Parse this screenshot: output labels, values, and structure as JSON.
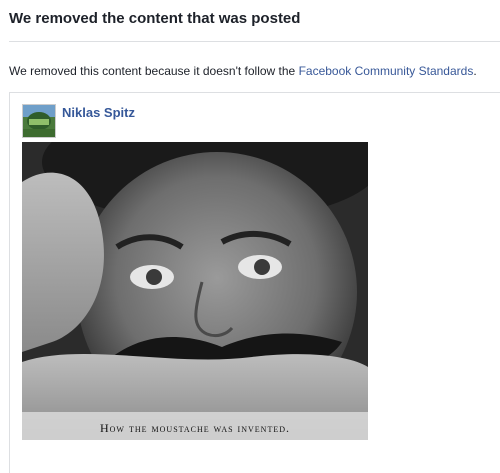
{
  "header": {
    "title": "We removed the content that was posted"
  },
  "notice": {
    "prefix": "We removed this content because it doesn't follow the ",
    "link": "Facebook Community Standards",
    "suffix": "."
  },
  "post": {
    "author": "Niklas Spitz",
    "avatar_icon": "profile-photo-landscape",
    "image_caption": "How the moustache was invented."
  }
}
